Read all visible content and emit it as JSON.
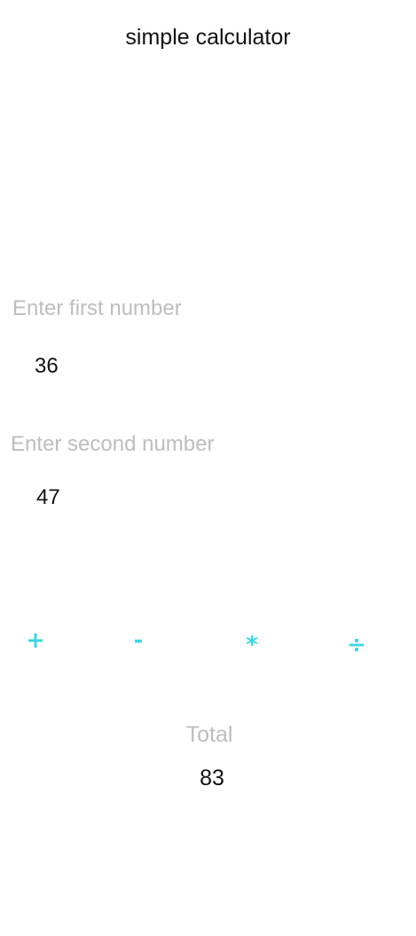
{
  "app": {
    "title": "simple calculator"
  },
  "first_number": {
    "hint": "Enter first number",
    "value": "36"
  },
  "second_number": {
    "hint": "Enter second number",
    "value": "47"
  },
  "operations": {
    "add": "+",
    "subtract": "-",
    "multiply": "*",
    "divide": "÷"
  },
  "result": {
    "label": "Total",
    "value": "83"
  },
  "colors": {
    "accent": "#3fd6df",
    "hint": "#bdbdbd",
    "text": "#111111"
  }
}
